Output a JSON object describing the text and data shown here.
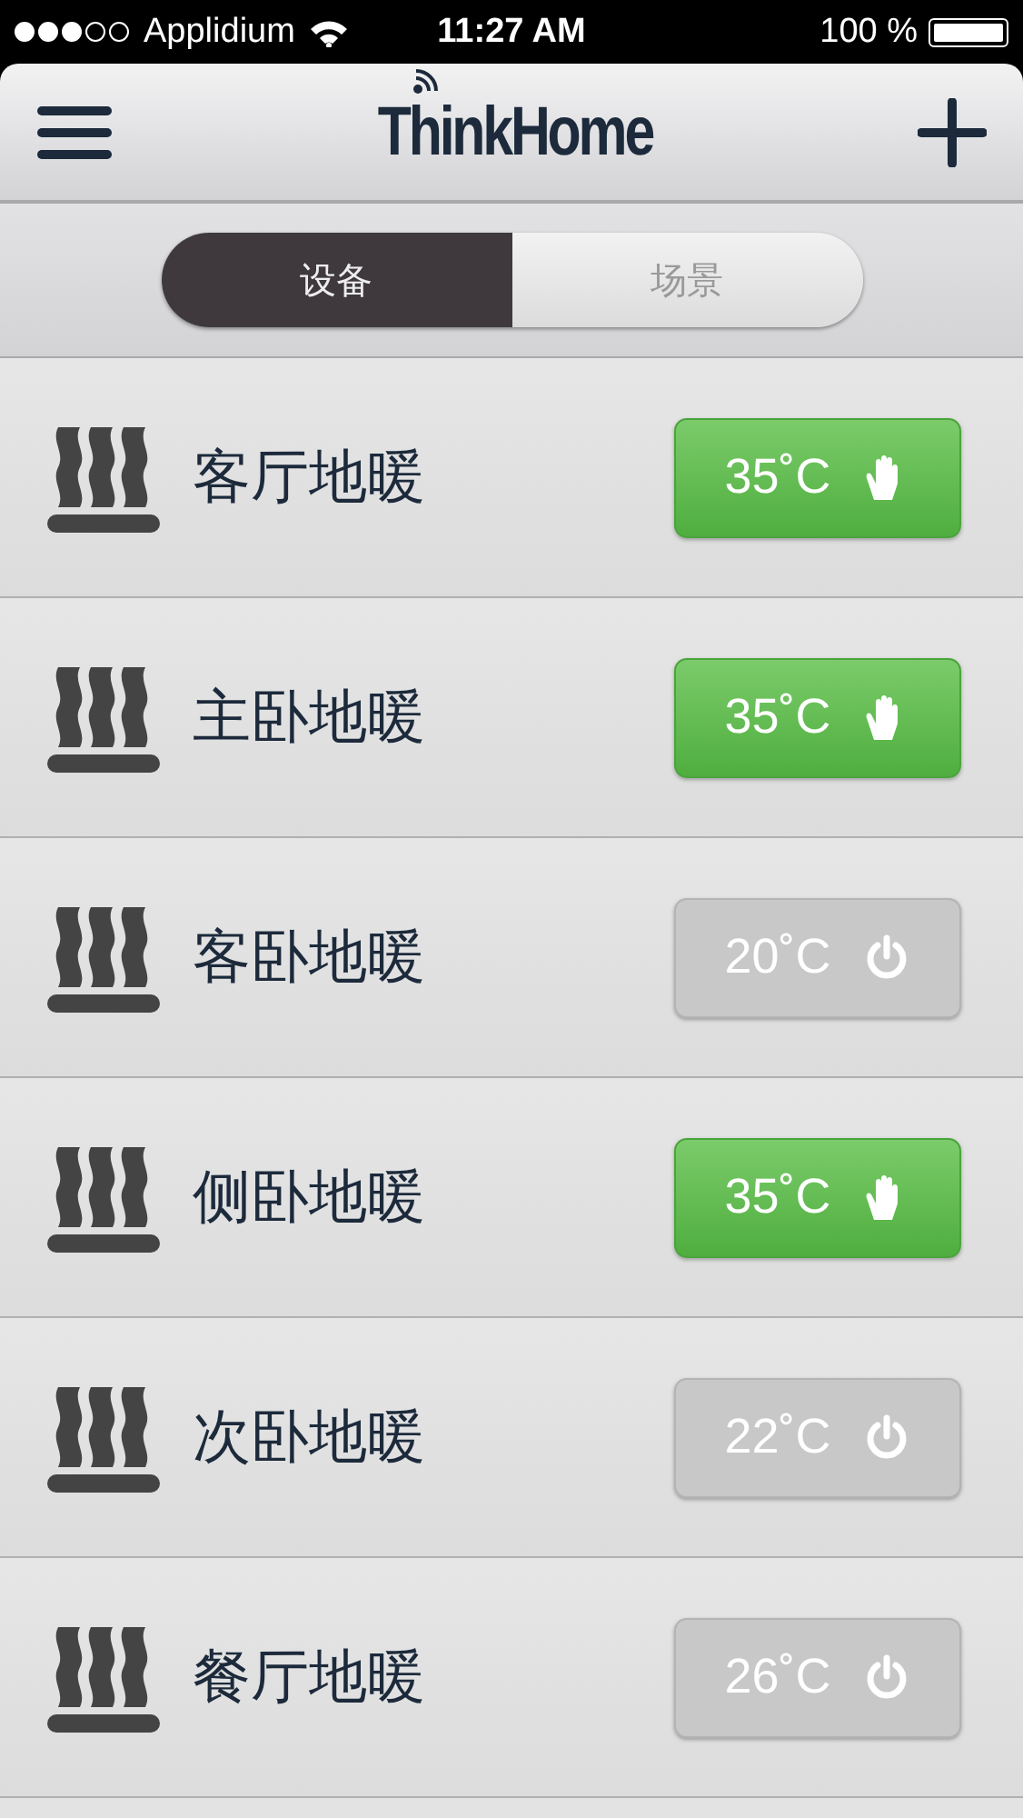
{
  "status_bar": {
    "carrier": "Applidium",
    "time": "11:27 AM",
    "battery": "100 %"
  },
  "header": {
    "logo": "ThinkHome"
  },
  "segments": [
    {
      "label": "设备",
      "selected": true
    },
    {
      "label": "场景",
      "selected": false
    }
  ],
  "devices": [
    {
      "name": "客厅地暖",
      "temperature": "35˚C",
      "on": true
    },
    {
      "name": "主卧地暖",
      "temperature": "35˚C",
      "on": true
    },
    {
      "name": "客卧地暖",
      "temperature": "20˚C",
      "on": false
    },
    {
      "name": "侧卧地暖",
      "temperature": "35˚C",
      "on": true
    },
    {
      "name": "次卧地暖",
      "temperature": "22˚C",
      "on": false
    },
    {
      "name": "餐厅地暖",
      "temperature": "26˚C",
      "on": false
    }
  ]
}
